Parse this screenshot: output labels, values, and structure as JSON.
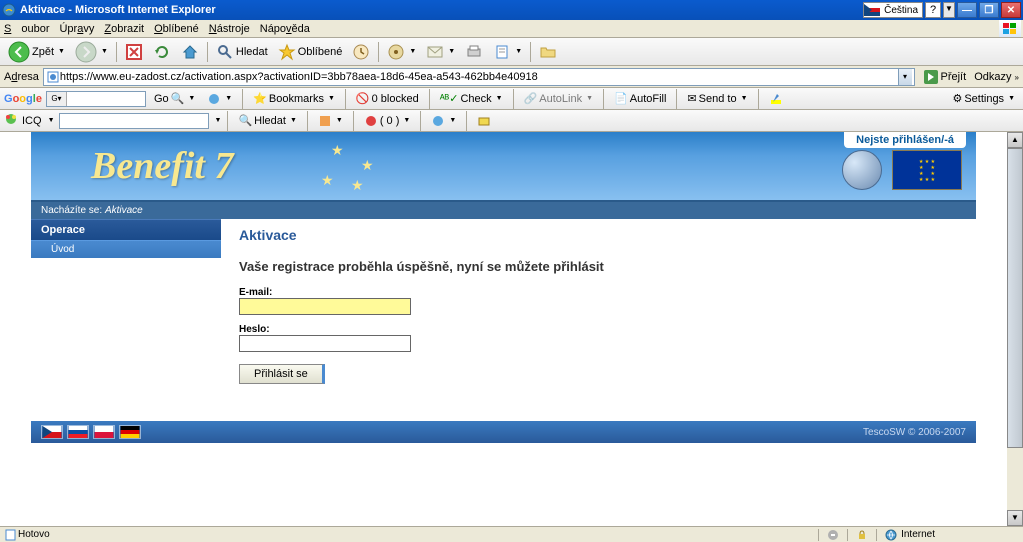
{
  "window": {
    "title": "Aktivace - Microsoft Internet Explorer",
    "language": "Čeština"
  },
  "menubar": {
    "items": [
      "Soubor",
      "Úpravy",
      "Zobrazit",
      "Oblíbené",
      "Nástroje",
      "Nápověda"
    ]
  },
  "toolbar": {
    "back": "Zpět",
    "search": "Hledat",
    "favorites": "Oblíbené"
  },
  "addressbar": {
    "label": "Adresa",
    "url": "https://www.eu-zadost.cz/activation.aspx?activationID=3bb78aea-18d6-45ea-a543-462bb4e40918",
    "go": "Přejít",
    "links": "Odkazy"
  },
  "googlebar": {
    "go": "Go",
    "bookmarks": "Bookmarks",
    "blocked": "0 blocked",
    "check": "Check",
    "autolink": "AutoLink",
    "autofill": "AutoFill",
    "sendto": "Send to",
    "settings": "Settings"
  },
  "icqbar": {
    "label": "ICQ",
    "search": "Hledat",
    "badge": "( 0 )"
  },
  "banner": {
    "product": "Benefit 7",
    "login_status": "Nejste přihlášen/-á"
  },
  "breadcrumb": {
    "prefix": "Nacházíte se:",
    "current": "Aktivace"
  },
  "sidebar": {
    "head": "Operace",
    "items": [
      {
        "label": "Úvod"
      }
    ]
  },
  "form": {
    "title": "Aktivace",
    "success": "Vaše registrace proběhla úspěšně, nyní se můžete přihlásit",
    "email_label": "E-mail:",
    "password_label": "Heslo:",
    "email_value": "",
    "password_value": "",
    "submit": "Přihlásit se"
  },
  "footer": {
    "copyright": "TescoSW © 2006-2007"
  },
  "statusbar": {
    "status": "Hotovo",
    "zone": "Internet"
  }
}
